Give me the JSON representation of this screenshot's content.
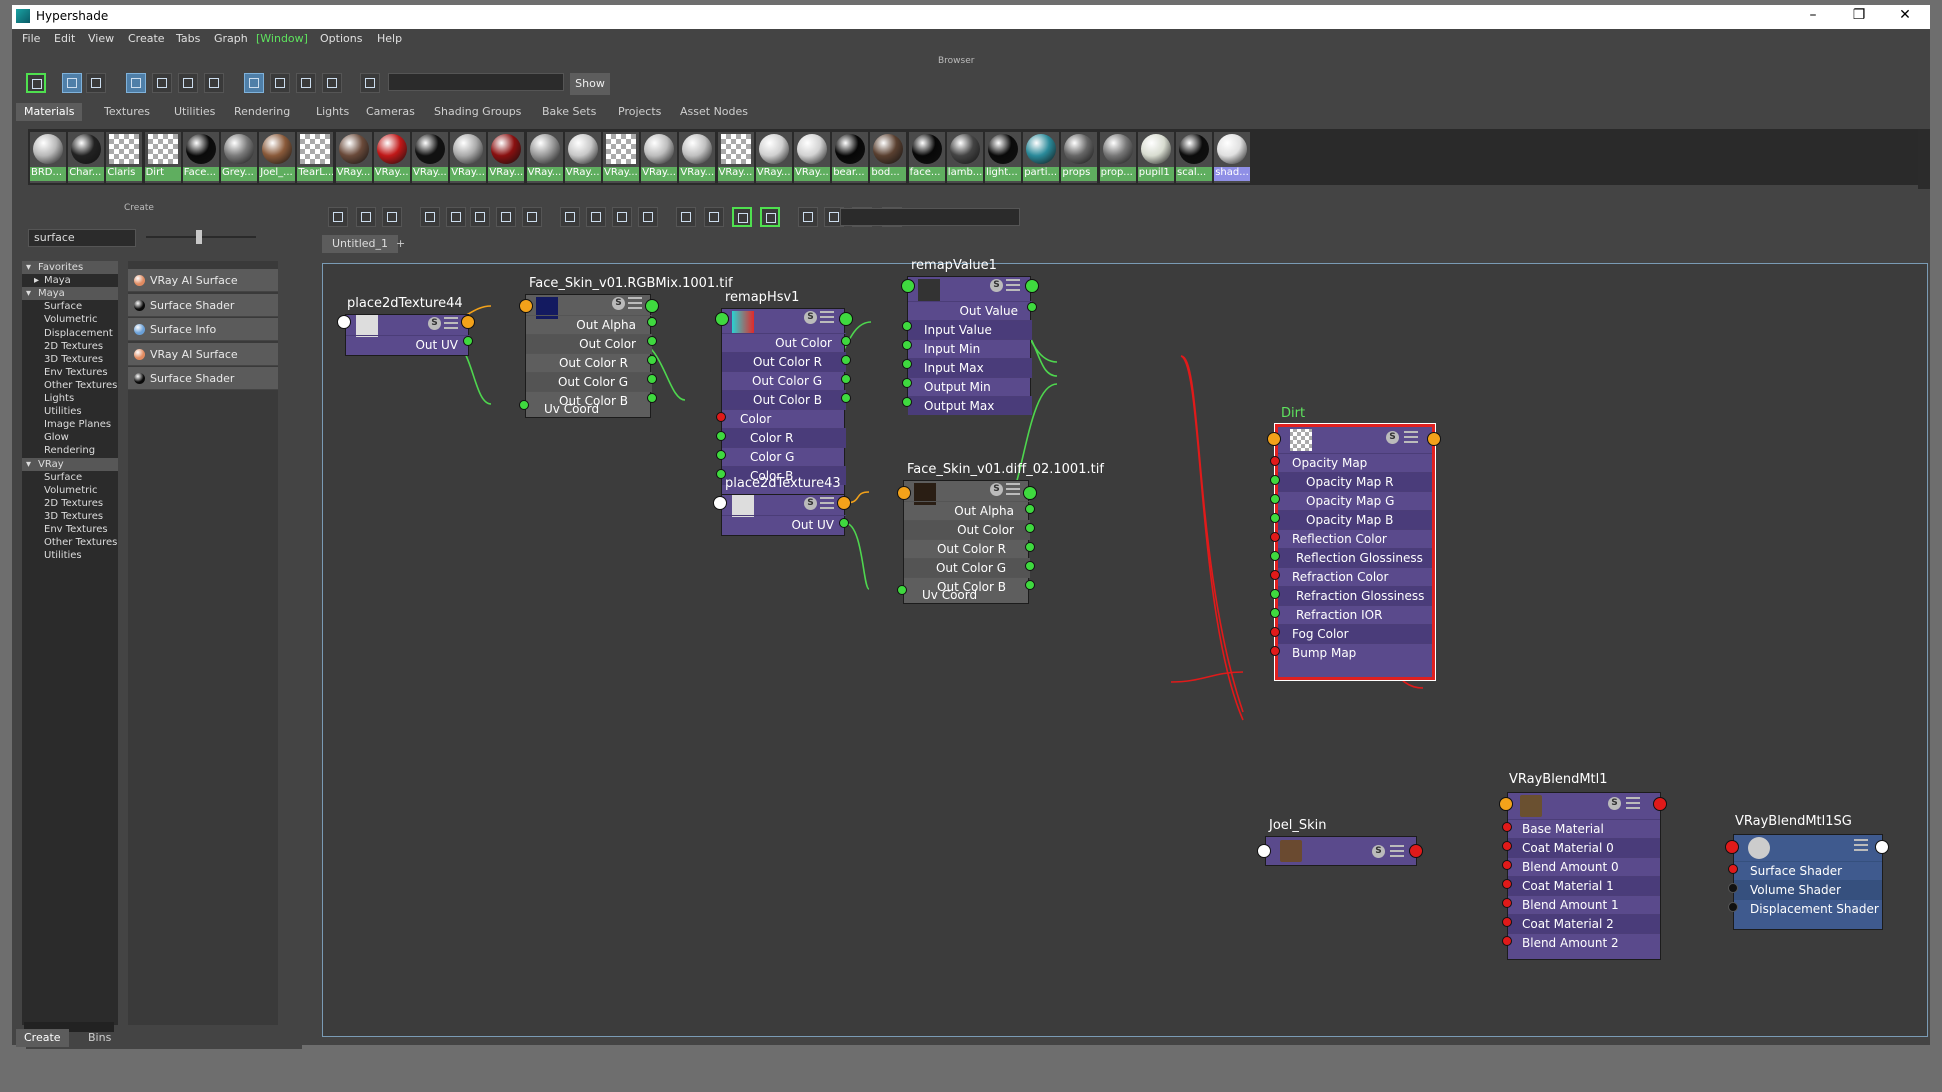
{
  "window": {
    "title": "Hypershade",
    "minimize": "–",
    "restore": "❐",
    "close": "✕"
  },
  "menu": [
    "File",
    "Edit",
    "View",
    "Create",
    "Tabs",
    "Graph",
    "[Window]",
    "Options",
    "Help"
  ],
  "browser": {
    "label": "Browser",
    "search_value": "",
    "show_button": "Show",
    "tabs": [
      "Materials",
      "Textures",
      "Utilities",
      "Rendering",
      "Lights",
      "Cameras",
      "Shading Groups",
      "Bake Sets",
      "Projects",
      "Asset Nodes"
    ],
    "active_tab": "Materials",
    "swatches": [
      {
        "label": "BRD...",
        "color": "#b8b8b8"
      },
      {
        "label": "Char...",
        "color": "#222222"
      },
      {
        "label": "Claris",
        "color": "checker"
      },
      {
        "label": "Dirt",
        "color": "checker"
      },
      {
        "label": "Face...",
        "color": "#0a0a0a"
      },
      {
        "label": "Grey...",
        "color": "#7a7a7a"
      },
      {
        "label": "Joel_...",
        "color": "#8a5a3a"
      },
      {
        "label": "TearL...",
        "color": "checker"
      },
      {
        "label": "VRay...",
        "color": "#6a4a3a"
      },
      {
        "label": "VRay...",
        "color": "#c01818"
      },
      {
        "label": "VRay...",
        "color": "#111111"
      },
      {
        "label": "VRay...",
        "color": "#aaaaaa"
      },
      {
        "label": "VRay...",
        "color": "#8a1010"
      },
      {
        "label": "VRay...",
        "color": "#999999"
      },
      {
        "label": "VRay...",
        "color": "#c8c8c8"
      },
      {
        "label": "VRay...",
        "color": "checker"
      },
      {
        "label": "VRay...",
        "color": "#bdbdbd"
      },
      {
        "label": "VRay...",
        "color": "#c0c0c0"
      },
      {
        "label": "VRay...",
        "color": "checker"
      },
      {
        "label": "VRay...",
        "color": "#d0d0d0"
      },
      {
        "label": "VRay...",
        "color": "#d2d2d2"
      },
      {
        "label": "bear...",
        "color": "#060606"
      },
      {
        "label": "bod...",
        "color": "#5a4030"
      },
      {
        "label": "face...",
        "color": "#070707"
      },
      {
        "label": "lamb...",
        "color": "#444444"
      },
      {
        "label": "light...",
        "color": "#0a0a0a"
      },
      {
        "label": "parti...",
        "color": "#2a8a9a"
      },
      {
        "label": "props",
        "color": "#666666"
      },
      {
        "label": "prop...",
        "color": "#777777"
      },
      {
        "label": "pupil1",
        "color": "#d8dcd0"
      },
      {
        "label": "scal...",
        "color": "#0c0c0c"
      },
      {
        "label": "shad...",
        "color": "#e0e0e0"
      }
    ]
  },
  "create_panel": {
    "title": "Create",
    "search_value": "surface",
    "categories": [
      {
        "label": "Favorites",
        "kind": "header",
        "indent": 0
      },
      {
        "label": "Maya",
        "kind": "collapsed",
        "indent": 1
      },
      {
        "label": "Maya",
        "kind": "header",
        "indent": 0
      },
      {
        "label": "Surface",
        "kind": "item",
        "indent": 1
      },
      {
        "label": "Volumetric",
        "kind": "item",
        "indent": 1
      },
      {
        "label": "Displacement",
        "kind": "item",
        "indent": 1
      },
      {
        "label": "2D Textures",
        "kind": "item",
        "indent": 1
      },
      {
        "label": "3D Textures",
        "kind": "item",
        "indent": 1
      },
      {
        "label": "Env Textures",
        "kind": "item",
        "indent": 1
      },
      {
        "label": "Other Textures",
        "kind": "item",
        "indent": 1
      },
      {
        "label": "Lights",
        "kind": "item",
        "indent": 1
      },
      {
        "label": "Utilities",
        "kind": "item",
        "indent": 1
      },
      {
        "label": "Image Planes",
        "kind": "item",
        "indent": 1
      },
      {
        "label": "Glow",
        "kind": "item",
        "indent": 1
      },
      {
        "label": "Rendering",
        "kind": "item",
        "indent": 1
      },
      {
        "label": "VRay",
        "kind": "header",
        "indent": 0
      },
      {
        "label": "Surface",
        "kind": "item",
        "indent": 1
      },
      {
        "label": "Volumetric",
        "kind": "item",
        "indent": 1
      },
      {
        "label": "2D Textures",
        "kind": "item",
        "indent": 1
      },
      {
        "label": "3D Textures",
        "kind": "item",
        "indent": 1
      },
      {
        "label": "Env Textures",
        "kind": "item",
        "indent": 1
      },
      {
        "label": "Other Textures",
        "kind": "item",
        "indent": 1
      },
      {
        "label": "Utilities",
        "kind": "item",
        "indent": 1
      }
    ],
    "items": [
      {
        "label": "VRay Al Surface",
        "icon": "#e08a60"
      },
      {
        "label": "Surface Shader",
        "icon": "#0a0a0a"
      },
      {
        "label": "Surface Info",
        "icon": "#6aa0d8"
      },
      {
        "label": "VRay Al Surface",
        "icon": "#e08a60"
      },
      {
        "label": "Surface Shader",
        "icon": "#0a0a0a"
      }
    ],
    "bottom_tabs": [
      "Create",
      "Bins"
    ]
  },
  "graph": {
    "tab": "Untitled_1",
    "add_tab": "+",
    "search_value": "",
    "nodes": {
      "place2d44": {
        "name": "place2dTexture44",
        "attrs": [
          "Out UV"
        ]
      },
      "faceRGB": {
        "name": "Face_Skin_v01.RGBMix.1001.tif",
        "attrs": [
          "Out Alpha",
          "Out Color",
          "Out Color R",
          "Out Color G",
          "Out Color B",
          "Uv Coord"
        ]
      },
      "remapHsv": {
        "name": "remapHsv1",
        "attrs": [
          "Out Color",
          "Out Color R",
          "Out Color G",
          "Out Color B",
          "Color",
          "Color R",
          "Color G",
          "Color B"
        ]
      },
      "remapValue": {
        "name": "remapValue1",
        "attrs": [
          "Out Value",
          "Input Value",
          "Input Min",
          "Input Max",
          "Output Min",
          "Output Max"
        ]
      },
      "place2d43": {
        "name": "place2dTexture43",
        "attrs": [
          "Out UV"
        ]
      },
      "faceDiff": {
        "name": "Face_Skin_v01.diff_02.1001.tif",
        "attrs": [
          "Out Alpha",
          "Out Color",
          "Out Color R",
          "Out Color G",
          "Out Color B",
          "Uv Coord"
        ]
      },
      "dirt": {
        "name": "Dirt",
        "attrs": [
          "Opacity Map",
          "Opacity Map R",
          "Opacity Map G",
          "Opacity Map B",
          "Reflection Color",
          "Reflection Glossiness",
          "Refraction Color",
          "Refraction Glossiness",
          "Refraction IOR",
          "Fog Color",
          "Bump Map"
        ]
      },
      "joel": {
        "name": "Joel_Skin",
        "attrs": []
      },
      "blend": {
        "name": "VRayBlendMtl1",
        "attrs": [
          "Base Material",
          "Coat Material 0",
          "Blend Amount 0",
          "Coat Material 1",
          "Blend Amount 1",
          "Coat Material 2",
          "Blend Amount 2"
        ]
      },
      "sg": {
        "name": "VRayBlendMtl1SG",
        "attrs": [
          "Surface Shader",
          "Volume Shader",
          "Displacement Shader"
        ]
      }
    },
    "colors": {
      "node": "#5a4a8c",
      "texture_node": "#5e5e5e",
      "sg_node": "#3f5a8e",
      "wire_green": "#4ed64e",
      "wire_orange": "#f3a21a",
      "wire_red": "#e01a1a",
      "selection": "#e02020"
    }
  }
}
